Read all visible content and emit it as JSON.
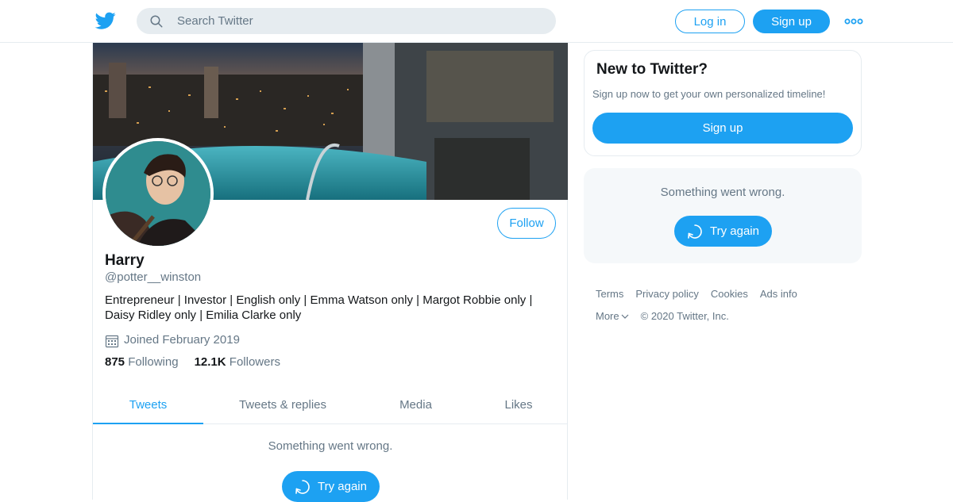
{
  "header": {
    "logo_icon": "twitter-bird-icon",
    "search_placeholder": "Search Twitter",
    "login_label": "Log in",
    "signup_label": "Sign up",
    "more_icon": "more-dots-icon"
  },
  "profile": {
    "name": "Harry",
    "handle": "@potter__winston",
    "bio": "Entrepreneur | Investor | English only | Emma Watson only | Margot Robbie only | Daisy Ridley only | Emilia Clarke only",
    "joined": "Joined February 2019",
    "follow_label": "Follow",
    "following_count": "875",
    "following_label": "Following",
    "followers_count": "12.1K",
    "followers_label": "Followers"
  },
  "tabs": [
    {
      "label": "Tweets",
      "active": true
    },
    {
      "label": "Tweets & replies",
      "active": false
    },
    {
      "label": "Media",
      "active": false
    },
    {
      "label": "Likes",
      "active": false
    }
  ],
  "timeline": {
    "error_message": "Something went wrong.",
    "retry_label": "Try again"
  },
  "sidebar": {
    "new_title": "New to Twitter?",
    "new_subtitle": "Sign up now to get your own personalized timeline!",
    "signup_label": "Sign up",
    "error_message": "Something went wrong.",
    "retry_label": "Try again"
  },
  "footer": {
    "links": [
      "Terms",
      "Privacy policy",
      "Cookies",
      "Ads info"
    ],
    "more_label": "More",
    "copyright": "© 2020 Twitter, Inc."
  },
  "colors": {
    "accent": "#1da1f2",
    "secondary_text": "#657786",
    "border": "#e6ecf0"
  }
}
